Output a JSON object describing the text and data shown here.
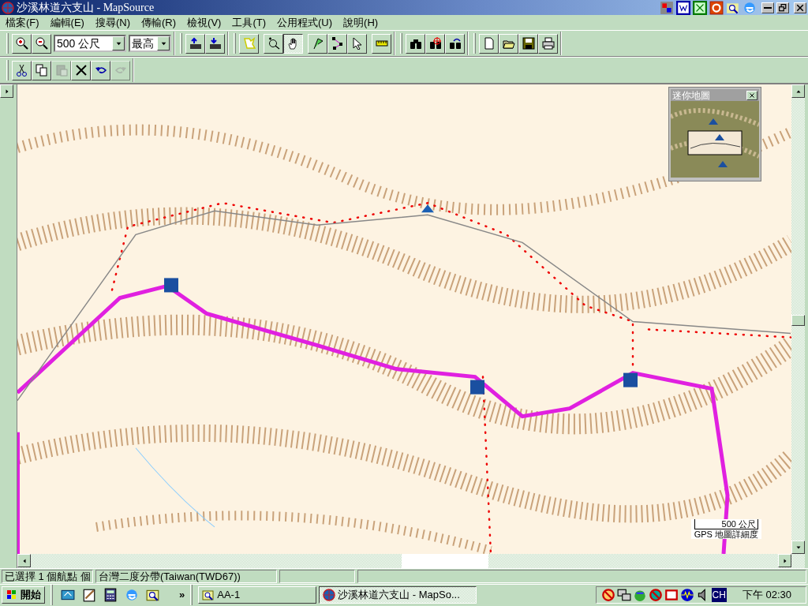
{
  "window": {
    "title": "沙溪林道六支山 - MapSource"
  },
  "menu": [
    {
      "label": "檔案(F)"
    },
    {
      "label": "編輯(E)"
    },
    {
      "label": "搜尋(N)"
    },
    {
      "label": "傳輸(R)"
    },
    {
      "label": "檢視(V)"
    },
    {
      "label": "工具(T)"
    },
    {
      "label": "公用程式(U)"
    },
    {
      "label": "說明(H)"
    }
  ],
  "toolbar": {
    "zoom_dropdown": {
      "value": "500 公尺"
    },
    "detail_dropdown": {
      "value": "最高"
    },
    "tools": [
      {
        "selected": false
      },
      {
        "selected": false
      },
      {
        "selected": false
      },
      {
        "selected": true
      },
      {
        "selected": false
      },
      {
        "selected": false
      },
      {
        "selected": false
      },
      {
        "selected": false
      }
    ]
  },
  "edit_toolbar": [
    {
      "disabled": false
    },
    {
      "disabled": false
    },
    {
      "disabled": true
    },
    {
      "disabled": false
    },
    {
      "disabled": false
    },
    {
      "disabled": true
    }
  ],
  "map": {
    "kind": "picture",
    "scale": {
      "label": "500 公尺",
      "detail_label": "GPS 地圖詳細度"
    },
    "mini_map": {
      "title": "迷你地圖"
    }
  },
  "status_bar": [
    {
      "text": "已選擇 1 個航點 個"
    },
    {
      "text": "台灣二度分帶(Taiwan(TWD67))"
    }
  ],
  "taskbar": {
    "start": "開始",
    "more": "»",
    "tasks": [
      {
        "label": "AA-1",
        "selected": false
      },
      {
        "label": "沙溪林道六支山 - MapSo...",
        "selected": true
      }
    ],
    "tray_lang": "CH",
    "clock": "下午 02:30"
  }
}
